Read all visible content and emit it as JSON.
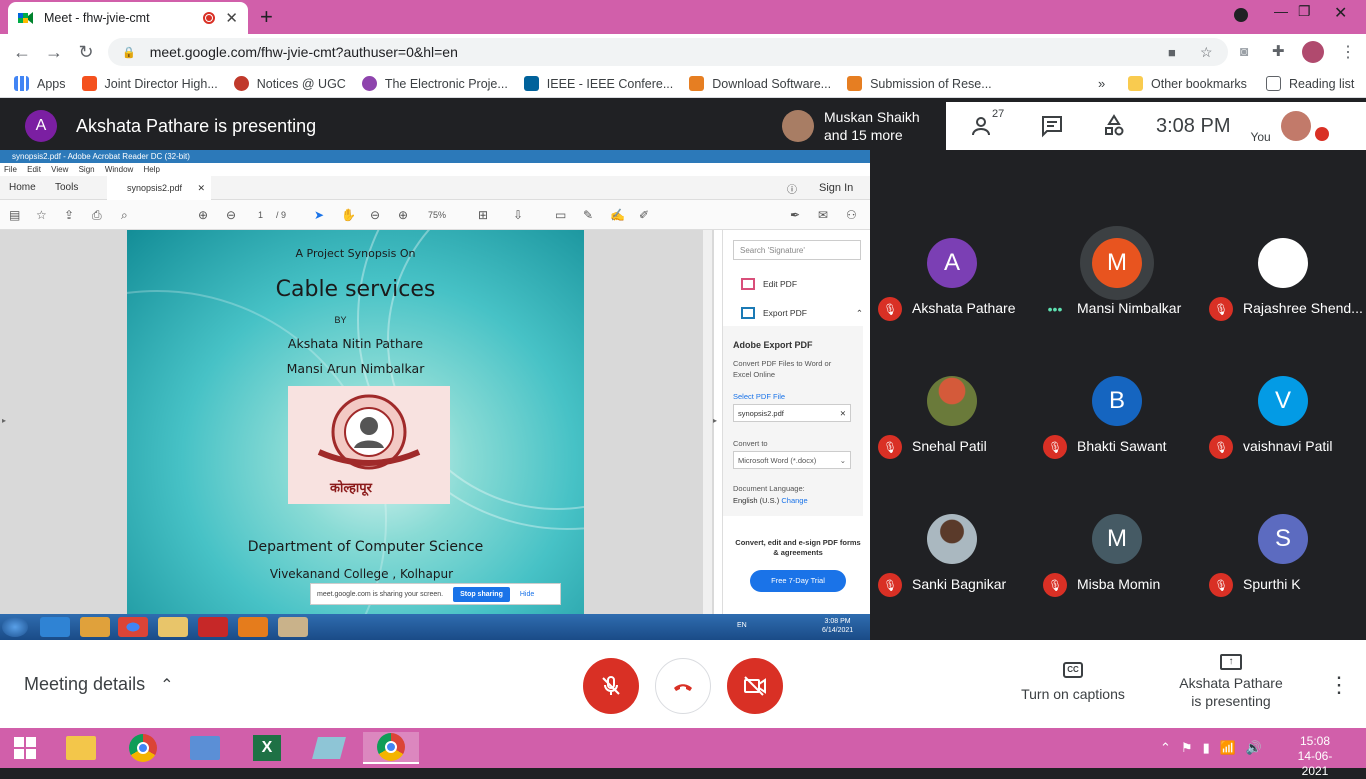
{
  "browser": {
    "tab_title": "Meet - fhw-jvie-cmt",
    "url": "meet.google.com/fhw-jvie-cmt?authuser=0&hl=en",
    "bookmarks": [
      "Apps",
      "Joint Director High...",
      "Notices @ UGC",
      "The Electronic Proje...",
      "IEEE - IEEE Confere...",
      "Download Software...",
      "Submission of Rese..."
    ],
    "other_bookmarks": "Other bookmarks",
    "reading_list": "Reading list"
  },
  "meet": {
    "presenter_initial": "A",
    "presenting_title": "Akshata Pathare is presenting",
    "participants_pill": {
      "line1": "Muskan Shaikh",
      "line2": "and 15 more"
    },
    "people_count": "27",
    "time": "3:08 PM",
    "you_label": "You",
    "tiles": [
      {
        "name": "Akshata Pathare",
        "initial": "A",
        "color": "#7b3fb4"
      },
      {
        "name": "Mansi Nimbalkar",
        "initial": "M",
        "color": "#e8541f"
      },
      {
        "name": "Rajashree Shend...",
        "initial": "",
        "color": "#ffffff"
      },
      {
        "name": "Snehal Patil",
        "initial": "",
        "color": "#5a6b3a"
      },
      {
        "name": "Bhakti Sawant",
        "initial": "B",
        "color": "#1565c0"
      },
      {
        "name": "vaishnavi Patil",
        "initial": "V",
        "color": "#039be5"
      },
      {
        "name": "Sanki Bagnikar",
        "initial": "",
        "color": "#8a9aa6"
      },
      {
        "name": "Misba Momin",
        "initial": "M",
        "color": "#455a64"
      },
      {
        "name": "Spurthi K",
        "initial": "S",
        "color": "#5c6bc0"
      }
    ],
    "meeting_details": "Meeting details",
    "captions": "Turn on captions",
    "presenting_info": {
      "line1": "Akshata Pathare",
      "line2": "is presenting"
    }
  },
  "acrobat": {
    "window_title": "synopsis2.pdf - Adobe Acrobat Reader DC (32-bit)",
    "menu": [
      "File",
      "Edit",
      "View",
      "Sign",
      "Window",
      "Help"
    ],
    "tabs": {
      "home": "Home",
      "tools": "Tools",
      "doc": "synopsis2.pdf"
    },
    "sign_in": "Sign In",
    "page_num": "1",
    "page_total": "/ 9",
    "zoom": "75%",
    "document": {
      "line1": "A Project Synopsis On",
      "title": "Cable services",
      "by": "BY",
      "author1": "Akshata Nitin Pathare",
      "author2": "Mansi Arun Nimbalkar",
      "seal_text": "कोल्हापूर",
      "dept": "Department of Computer Science",
      "college": "Vivekanand College , Kolhapur"
    },
    "panel": {
      "search_placeholder": "Search 'Signature'",
      "edit_pdf": "Edit PDF",
      "export_pdf": "Export PDF",
      "export_heading": "Adobe Export PDF",
      "export_desc": "Convert PDF Files to Word or Excel Online",
      "select_file": "Select PDF File",
      "file": "synopsis2.pdf",
      "convert_to": "Convert to",
      "format": "Microsoft Word (*.docx)",
      "doc_lang_label": "Document Language:",
      "doc_lang": "English (U.S.)",
      "change": "Change",
      "promo": "Convert, edit and e-sign PDF forms & agreements",
      "trial": "Free 7-Day Trial"
    },
    "share_bar": {
      "text": "meet.google.com is sharing your screen.",
      "stop": "Stop sharing",
      "hide": "Hide"
    },
    "win7_tray": {
      "lang": "EN",
      "time": "3:08 PM",
      "date": "6/14/2021"
    }
  },
  "taskbar": {
    "time": "15:08",
    "date": "14-06-2021"
  }
}
